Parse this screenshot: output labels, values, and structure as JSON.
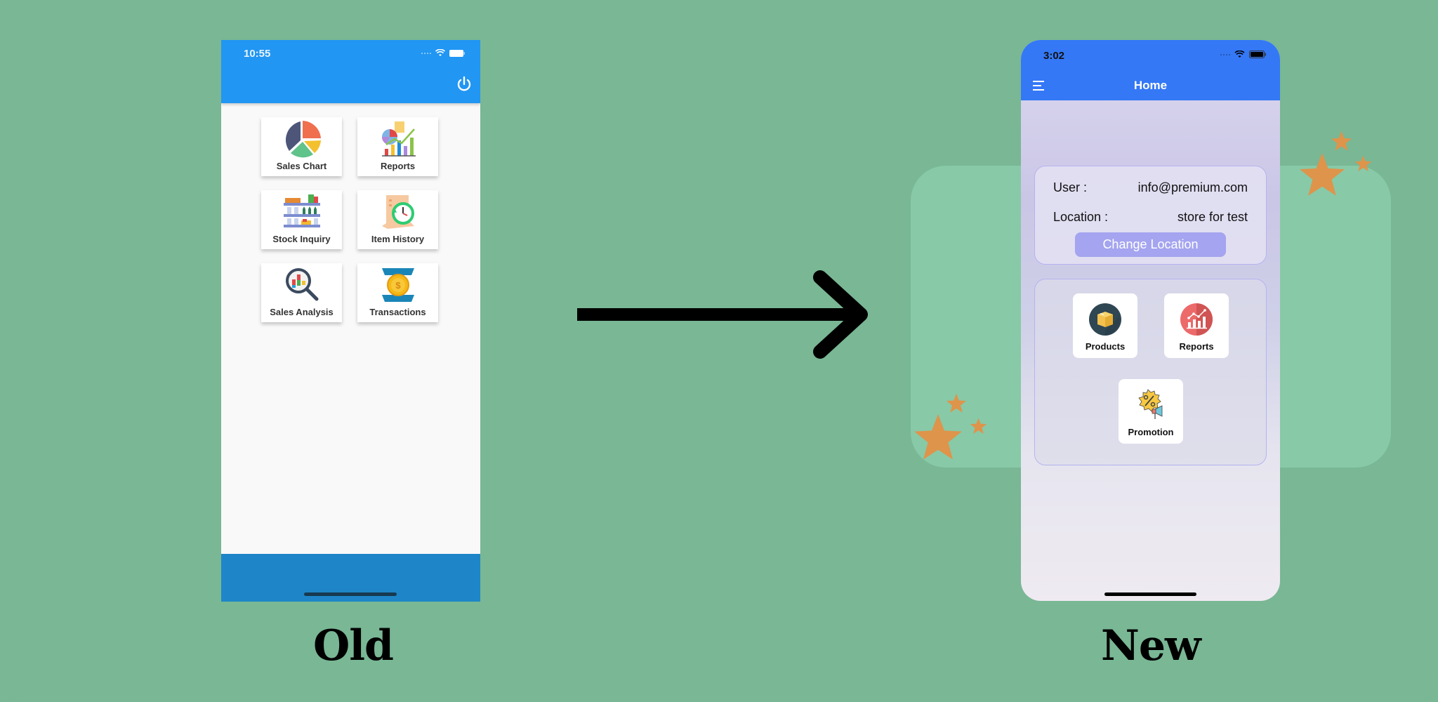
{
  "old_screen": {
    "status_time": "10:55",
    "header_icon": "power-icon",
    "tiles": [
      {
        "label": "Sales Chart",
        "icon": "pie-chart-icon"
      },
      {
        "label": "Reports",
        "icon": "report-chart-icon"
      },
      {
        "label": "Stock Inquiry",
        "icon": "shelf-stock-icon"
      },
      {
        "label": "Item History",
        "icon": "history-clock-icon"
      },
      {
        "label": "Sales Analysis",
        "icon": "magnifier-chart-icon"
      },
      {
        "label": "Transactions",
        "icon": "coin-transfer-icon"
      }
    ],
    "caption": "Old",
    "colors": {
      "header": "#2196f3",
      "footer": "#1e86c8"
    }
  },
  "new_screen": {
    "status_time": "3:02",
    "header_title": "Home",
    "info": {
      "user_label": "User :",
      "user_value": "info@premium.com",
      "location_label": "Location :",
      "location_value": "store for test",
      "change_location_label": "Change Location"
    },
    "tiles": [
      {
        "label": "Products",
        "icon": "box-icon"
      },
      {
        "label": "Reports",
        "icon": "report-chart-icon"
      },
      {
        "label": "Promotion",
        "icon": "promotion-megaphone-icon"
      }
    ],
    "caption": "New",
    "colors": {
      "header": "#3478f6",
      "button": "#a4a4f0"
    }
  },
  "background_color": "#79b795",
  "accent_star_color": "#de944b"
}
